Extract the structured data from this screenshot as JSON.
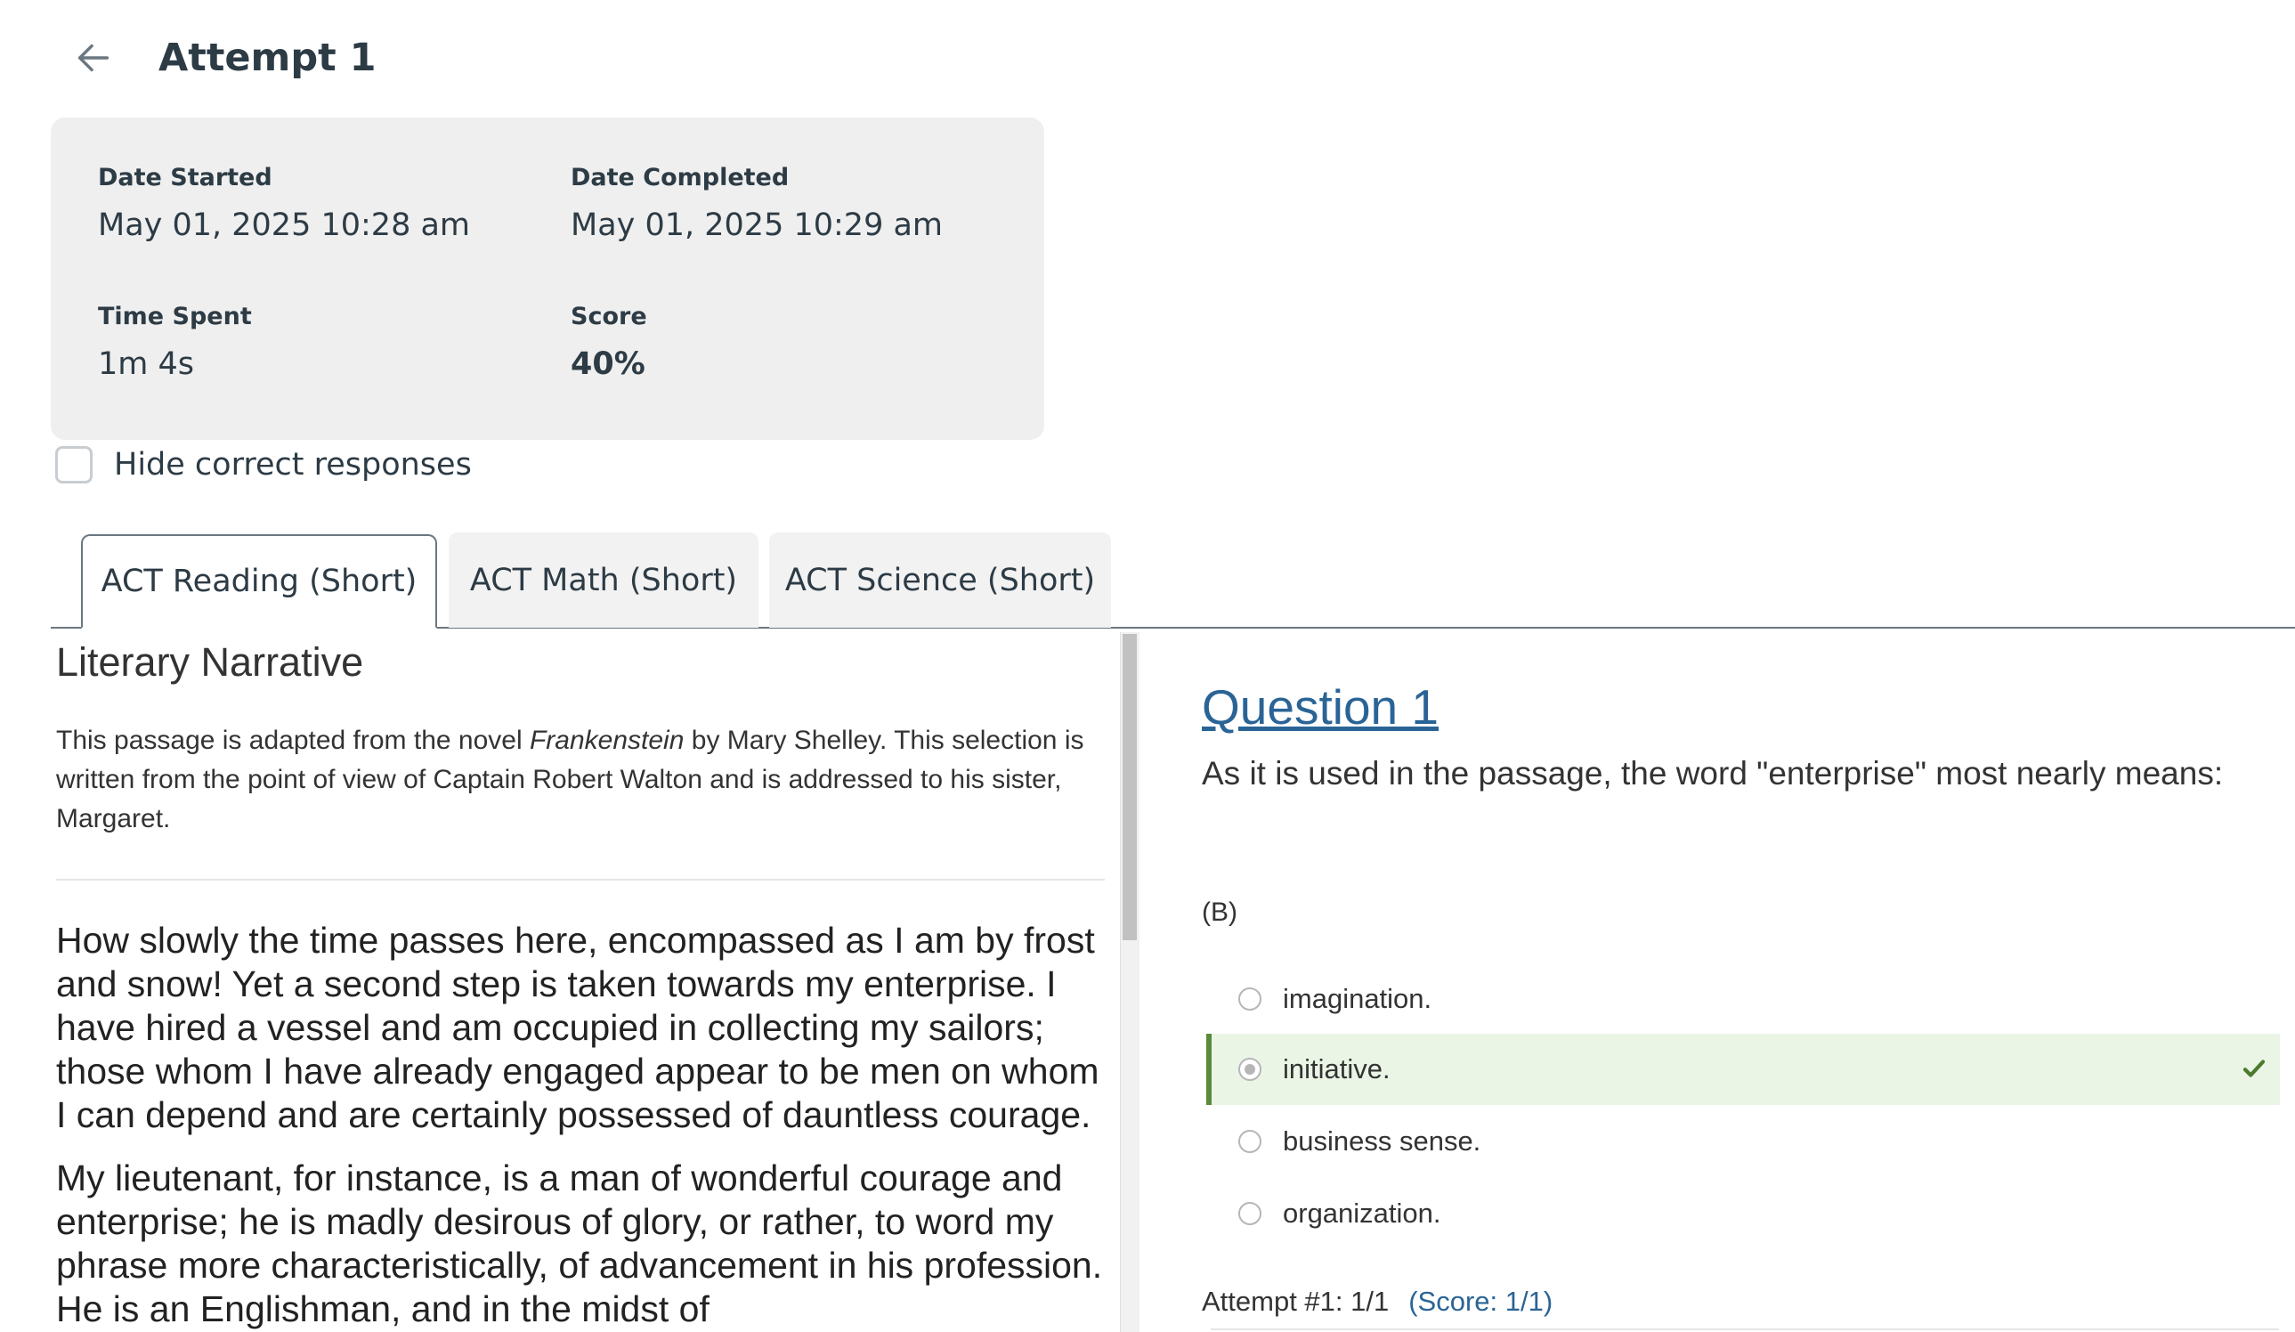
{
  "header": {
    "title": "Attempt 1",
    "back_icon": "arrow-left-icon"
  },
  "info": {
    "date_started_label": "Date Started",
    "date_started_value": "May 01, 2025 10:28 am",
    "date_completed_label": "Date Completed",
    "date_completed_value": "May 01, 2025 10:29 am",
    "time_spent_label": "Time Spent",
    "time_spent_value": "1m 4s",
    "score_label": "Score",
    "score_value": "40%"
  },
  "options": {
    "hide_correct_label": "Hide correct responses",
    "hide_correct_checked": false
  },
  "tabs": [
    {
      "label": "ACT Reading (Short)",
      "active": true
    },
    {
      "label": "ACT Math (Short)",
      "active": false
    },
    {
      "label": "ACT Science (Short)",
      "active": false
    }
  ],
  "passage": {
    "title": "Literary Narrative",
    "intro_before": "This passage is adapted from the novel ",
    "intro_italic": "Frankenstein",
    "intro_after": " by Mary Shelley. This selection is written from the point of view of Captain Robert Walton and is addressed to his sister, Margaret.",
    "paragraphs": [
      "How slowly the time passes here, encompassed as I am by frost and snow! Yet a second step is taken towards my enterprise. I have hired a vessel and am occupied in collecting my sailors; those whom I have already engaged appear to be men on whom I can depend and are certainly possessed of dauntless courage.",
      "My lieutenant, for instance, is a man of wonderful courage and enterprise; he is madly desirous of glory, or rather, to word my phrase more characteristically, of advancement in his profession. He is an Englishman, and in the midst of"
    ]
  },
  "question": {
    "title": "Question 1",
    "text": "As it is used in the passage, the word \"enterprise\" most nearly means:",
    "selected_answer": "(B)",
    "answers": [
      {
        "label": "imagination.",
        "selected": false,
        "correct": false
      },
      {
        "label": "initiative.",
        "selected": true,
        "correct": true
      },
      {
        "label": "business sense.",
        "selected": false,
        "correct": false
      },
      {
        "label": "organization.",
        "selected": false,
        "correct": false
      }
    ],
    "attempt_label": "Attempt #1: 1/1",
    "attempt_score": "(Score: 1/1)"
  },
  "colors": {
    "link": "#2a6496",
    "correct_bg": "#eaf5e6",
    "correct_border": "#5a8a3a",
    "card_bg": "#efefef"
  }
}
